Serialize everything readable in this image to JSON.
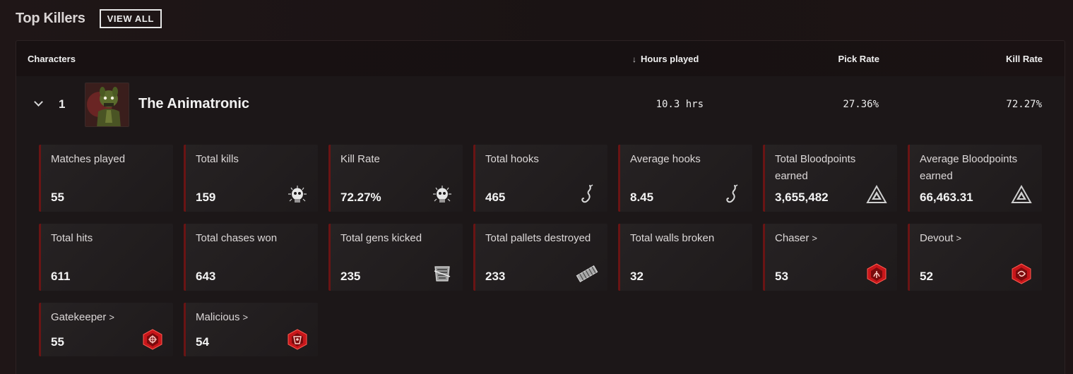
{
  "header": {
    "title": "Top Killers",
    "view_all_label": "VIEW ALL"
  },
  "table": {
    "columns": {
      "characters": "Characters",
      "hours": "Hours played",
      "pick": "Pick Rate",
      "kill": "Kill Rate"
    },
    "sort_icon": "arrow-down-icon",
    "rows": [
      {
        "rank": "1",
        "name": "The Animatronic",
        "hours": "10.3 hrs",
        "pick_rate": "27.36%",
        "kill_rate": "72.27%",
        "stats": [
          {
            "label": "Matches played",
            "value": "55",
            "icon": ""
          },
          {
            "label": "Total kills",
            "value": "159",
            "icon": "skull-icon"
          },
          {
            "label": "Kill Rate",
            "value": "72.27%",
            "icon": "skull-icon"
          },
          {
            "label": "Total hooks",
            "value": "465",
            "icon": "hook-icon"
          },
          {
            "label": "Average hooks",
            "value": "8.45",
            "icon": "hook-icon"
          },
          {
            "label": "Total Bloodpoints earned",
            "value": "3,655,482",
            "icon": "bloodpoints-icon"
          },
          {
            "label": "Average Bloodpoints earned",
            "value": "66,463.31",
            "icon": "bloodpoints-icon"
          },
          {
            "label": "Total hits",
            "value": "611",
            "icon": ""
          },
          {
            "label": "Total chases won",
            "value": "643",
            "icon": ""
          },
          {
            "label": "Total gens kicked",
            "value": "235",
            "icon": "generator-icon"
          },
          {
            "label": "Total pallets destroyed",
            "value": "233",
            "icon": "pallet-icon"
          },
          {
            "label": "Total walls broken",
            "value": "32",
            "icon": ""
          },
          {
            "label": "Chaser",
            "value": "53",
            "icon": "chaser-emblem-icon"
          },
          {
            "label": "Devout",
            "value": "52",
            "icon": "devout-emblem-icon"
          },
          {
            "label": "Gatekeeper",
            "value": "55",
            "icon": "gatekeeper-emblem-icon"
          },
          {
            "label": "Malicious",
            "value": "54",
            "icon": "malicious-emblem-icon"
          }
        ]
      }
    ]
  },
  "colors": {
    "accent": "#6a1414",
    "emblem_red": "#c8161a"
  }
}
